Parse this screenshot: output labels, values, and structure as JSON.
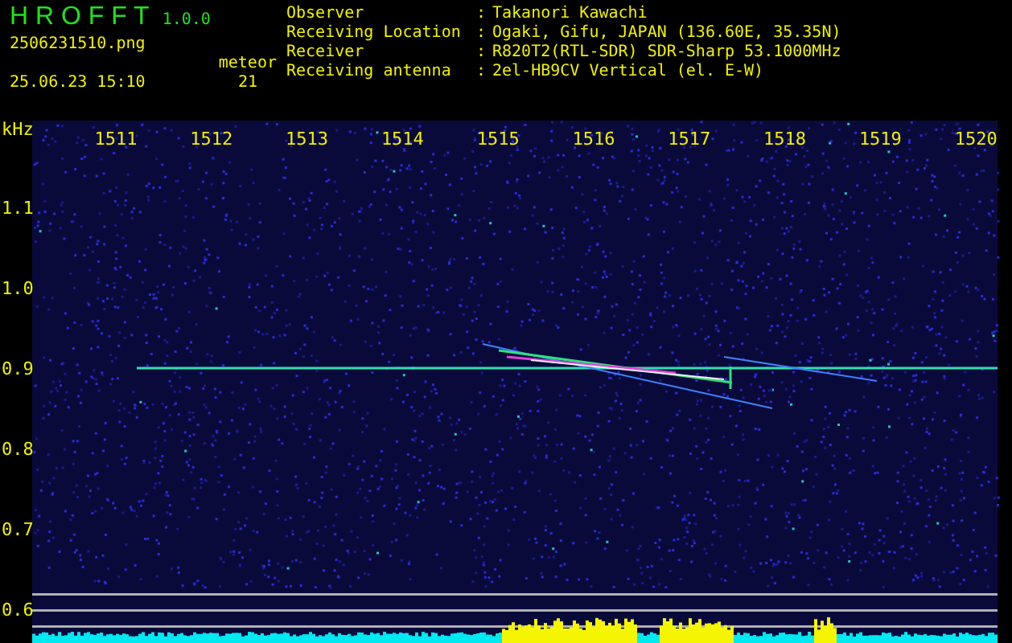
{
  "app": {
    "name": "H R O F F T",
    "version": "1.0.0"
  },
  "file": "2506231510.png",
  "datetime": "25.06.23 15:10",
  "detection": {
    "label": "meteor",
    "count": "21"
  },
  "info": [
    {
      "label": "Observer",
      "separator": ":",
      "value": "Takanori Kawachi"
    },
    {
      "label": "Receiving Location",
      "separator": ":",
      "value": "Ogaki, Gifu, JAPAN (136.60E, 35.35N)"
    },
    {
      "label": "Receiver",
      "separator": ":",
      "value": "R820T2(RTL-SDR) SDR-Sharp 53.1000MHz"
    },
    {
      "label": "Receiving antenna",
      "separator": ":",
      "value": "2el-HB9CV Vertical (el. E-W)"
    }
  ],
  "plot": {
    "unit": "kHz",
    "x_labels": [
      "1511",
      "1512",
      "1513",
      "1514",
      "1515",
      "1516",
      "1517",
      "1518",
      "1519",
      "1520"
    ],
    "y_labels": [
      "1.1",
      "1.0",
      "0.9",
      "0.8",
      "0.7",
      "0.6"
    ]
  }
}
